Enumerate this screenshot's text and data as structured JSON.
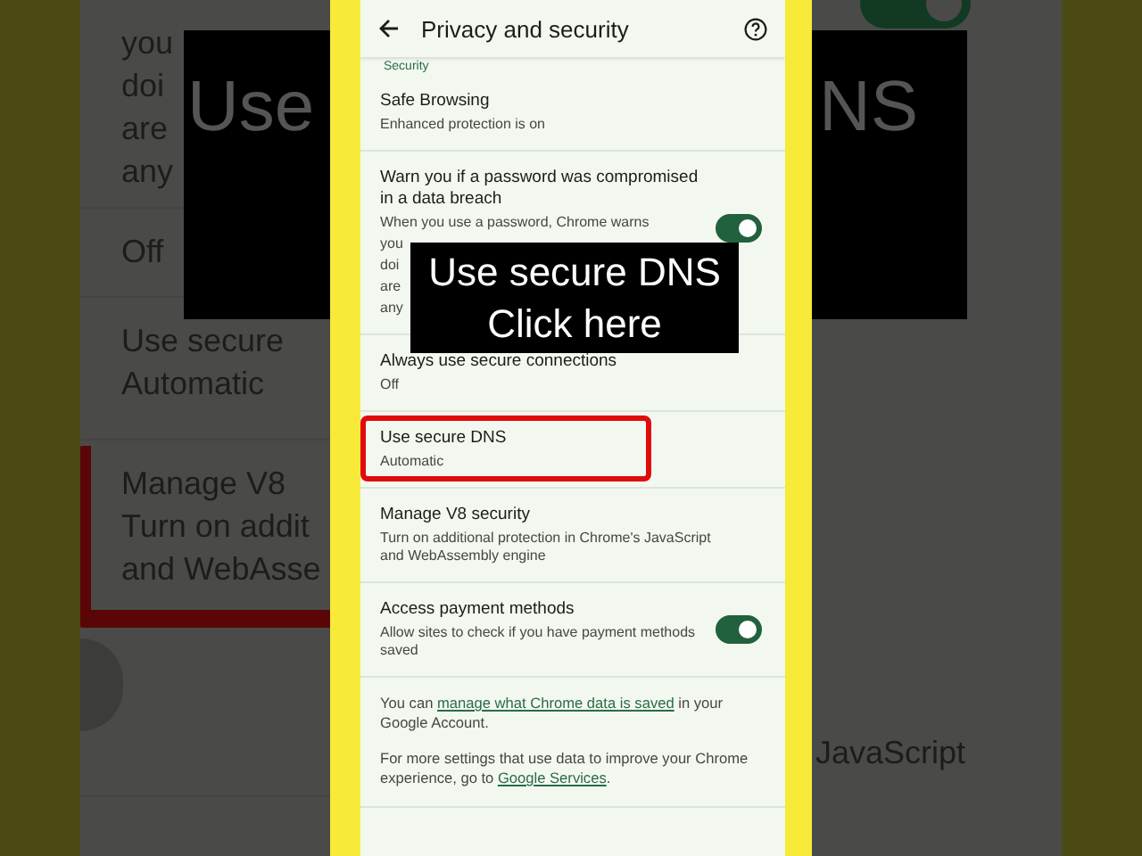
{
  "backdrop_left": {
    "sections": [
      {
        "lines": [
          "you",
          "doi",
          "are",
          "any"
        ]
      },
      {
        "lines": [
          "Off"
        ]
      },
      {
        "lines": [
          "Use secure",
          "Automatic"
        ]
      },
      {
        "lines": [
          "Manage V8",
          "Turn on addit",
          "and WebAsse"
        ]
      }
    ],
    "caption": "Use"
  },
  "backdrop_right": {
    "toggle_on": true,
    "caption": "NS",
    "tail": "JavaScript"
  },
  "header": {
    "title": "Privacy and security"
  },
  "section_label": "Security",
  "settings": [
    {
      "kind": "item",
      "title": "Safe Browsing",
      "subtitle": "Enhanced protection is on",
      "highlighted": false
    },
    {
      "kind": "toggle",
      "title": "Warn you if a password was compromised in a data breach",
      "subtitle_lines": [
        "When you use a password, Chrome warns",
        "you",
        "doi",
        "are",
        "any"
      ],
      "on": true,
      "highlighted": false
    },
    {
      "kind": "item",
      "title": "Always use secure connections",
      "subtitle": "Off",
      "highlighted": false
    },
    {
      "kind": "item",
      "title": "Use secure DNS",
      "subtitle": "Automatic",
      "highlighted": true
    },
    {
      "kind": "item",
      "title": "Manage V8 security",
      "subtitle": "Turn on additional protection in Chrome's JavaScript and WebAssembly engine",
      "highlighted": false
    },
    {
      "kind": "toggle",
      "title": "Access payment methods",
      "subtitle_lines": [
        "Allow sites to check if you have payment methods saved"
      ],
      "on": true,
      "highlighted": false
    }
  ],
  "notes": [
    {
      "before": "You can ",
      "link": "manage what Chrome data is saved",
      "after": " in your Google Account."
    },
    {
      "before": "For more settings that use data to improve your Chrome experience, go to ",
      "link": "Google Services",
      "after": "."
    }
  ],
  "callout": {
    "lines": [
      "Use secure DNS",
      "Click here"
    ]
  }
}
